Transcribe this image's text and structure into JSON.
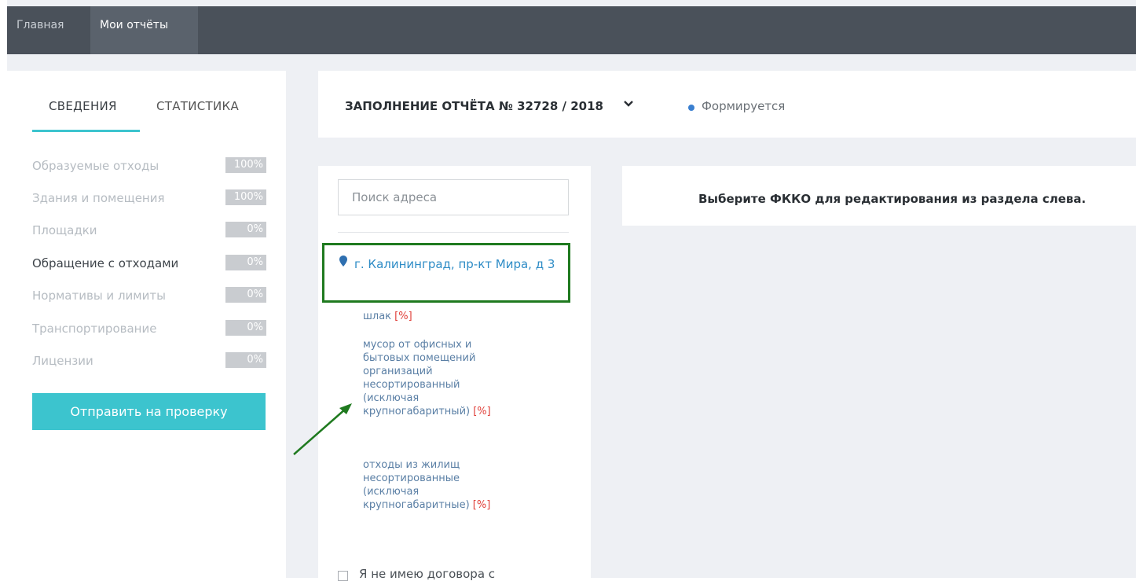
{
  "nav": {
    "items": [
      {
        "label": "Главная"
      },
      {
        "label": "Мои отчёты",
        "active": true
      }
    ]
  },
  "left": {
    "tabs": [
      {
        "label": "СВЕДЕНИЯ",
        "active": true
      },
      {
        "label": "СТАТИСТИКА"
      }
    ],
    "sections": [
      {
        "label": "Образуемые отходы",
        "percent": "100%"
      },
      {
        "label": "Здания и помещения",
        "percent": "100%"
      },
      {
        "label": "Площадки",
        "percent": "0%"
      },
      {
        "label": "Обращение с отходами",
        "percent": "0%",
        "active": true
      },
      {
        "label": "Нормативы и лимиты",
        "percent": "0%"
      },
      {
        "label": "Транспортирование",
        "percent": "0%"
      },
      {
        "label": "Лицензии",
        "percent": "0%"
      }
    ],
    "submit_label": "Отправить на проверку"
  },
  "report": {
    "title": "ЗАПОЛНЕНИЕ ОТЧЁТА № 32728 / 2018",
    "chevron_icon": "chevron-down-icon",
    "status": "Формируется",
    "status_color": "#3a7fd0"
  },
  "tree": {
    "search_placeholder": "Поиск адреса",
    "address": "г. Калининград, пр-кт Мира, д 3",
    "pin_icon": "map-marker-icon",
    "waste_items": [
      {
        "name": "шлак",
        "badge": "[%]"
      },
      {
        "name": "мусор от офисных и бытовых помещений организаций несортированный (исключая крупногабаритный)",
        "badge": "[%]"
      },
      {
        "name": "отходы из жилищ несортированные (исключая крупногабаритные)",
        "badge": "[%]"
      }
    ],
    "contract_label": "Я не имею договора с"
  },
  "info": {
    "message": "Выберите ФККО для редактирования из раздела слева."
  },
  "colors": {
    "accent": "#3cc4ce",
    "topbar": "#4a515a",
    "highlight_box": "#1f7a1f",
    "link": "#2e8cc6",
    "percent_badge": "#e0403a"
  }
}
